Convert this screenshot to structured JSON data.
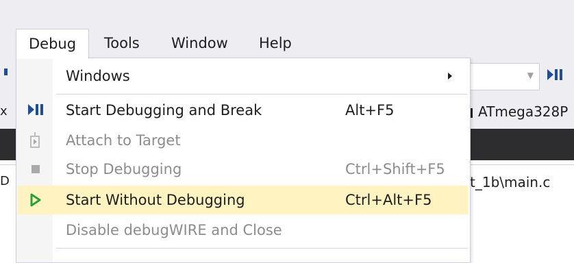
{
  "menubar": {
    "items": [
      {
        "label": "Debug"
      },
      {
        "label": "Tools"
      },
      {
        "label": "Window"
      },
      {
        "label": "Help"
      }
    ]
  },
  "background": {
    "left_fragment_1": "x",
    "left_fragment_2": "D",
    "device_label": "ATmega328P",
    "path_fragment": "t_1b\\main.c"
  },
  "dropdown": {
    "items": [
      {
        "label": "Windows",
        "shortcut": "",
        "icon": "none",
        "submenu": true
      },
      {
        "label": "Start Debugging and Break",
        "shortcut": "Alt+F5",
        "icon": "start-debug-break-icon"
      },
      {
        "label": "Attach to Target",
        "shortcut": "",
        "icon": "attach-target-icon"
      },
      {
        "label": "Stop Debugging",
        "shortcut": "Ctrl+Shift+F5",
        "icon": "stop-icon"
      },
      {
        "label": "Start Without Debugging",
        "shortcut": "Ctrl+Alt+F5",
        "icon": "play-icon"
      },
      {
        "label": "Disable debugWIRE and Close",
        "shortcut": "",
        "icon": "none"
      }
    ]
  },
  "colors": {
    "highlight": "#fff4c1",
    "play_green": "#2e9e3a",
    "debug_blue": "#1f4e99",
    "disabled_text": "#8c8c8c",
    "dark_band": "#2d2d30"
  }
}
